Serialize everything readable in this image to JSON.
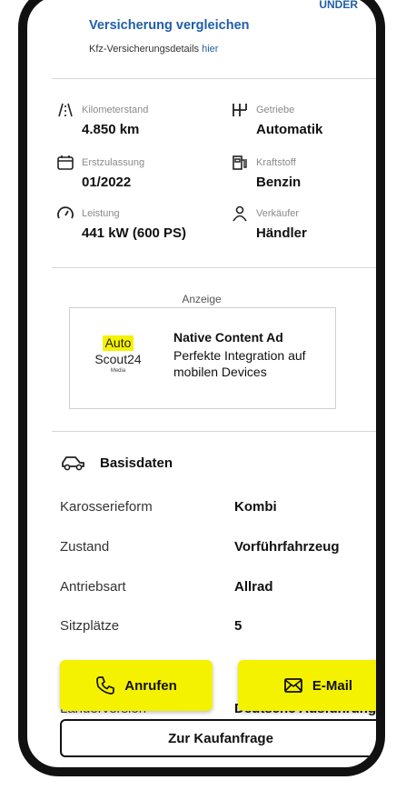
{
  "header": {
    "partial_text": "UNDER",
    "compare_link": "Versicherung vergleichen",
    "details_text": "Kfz-Versicherungsdetails",
    "details_link": "hier"
  },
  "specs": [
    {
      "icon": "mileage-icon",
      "label": "Kilometerstand",
      "value": "4.850 km"
    },
    {
      "icon": "gearbox-icon",
      "label": "Getriebe",
      "value": "Automatik"
    },
    {
      "icon": "calendar-icon",
      "label": "Erstzulassung",
      "value": "01/2022"
    },
    {
      "icon": "fuel-pump-icon",
      "label": "Kraftstoff",
      "value": "Benzin"
    },
    {
      "icon": "speedometer-icon",
      "label": "Leistung",
      "value": "441 kW (600 PS)"
    },
    {
      "icon": "person-icon",
      "label": "Verkäufer",
      "value": "Händler"
    }
  ],
  "ad": {
    "label": "Anzeige",
    "logo_auto": "Auto",
    "logo_scout": "Scout24",
    "logo_media": "Media",
    "title": "Native Content Ad",
    "text": "Perfekte Integration auf mobilen Devices"
  },
  "basisdaten": {
    "title": "Basisdaten",
    "rows": [
      {
        "label": "Karosserieform",
        "value": "Kombi"
      },
      {
        "label": "Zustand",
        "value": "Vorführfahrzeug"
      },
      {
        "label": "Antriebsart",
        "value": "Allrad"
      },
      {
        "label": "Sitzplätze",
        "value": "5"
      },
      {
        "label": "Länderversion",
        "value": "Deutsche Ausführung"
      }
    ]
  },
  "actions": {
    "call_label": "Anrufen",
    "email_label": "E-Mail",
    "purchase_label": "Zur Kaufanfrage"
  },
  "colors": {
    "accent_yellow": "#f5f200",
    "link_blue": "#1f5fa8"
  }
}
